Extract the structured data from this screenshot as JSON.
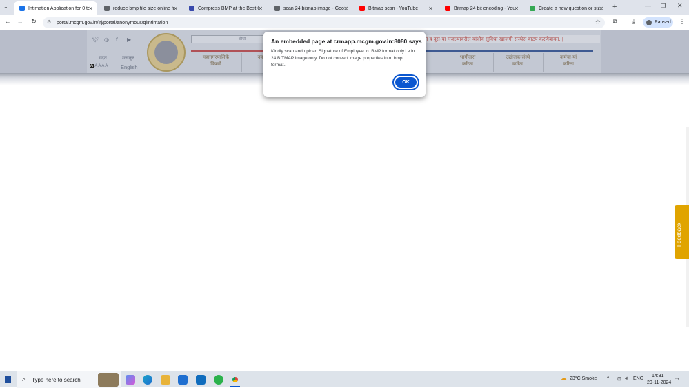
{
  "browser": {
    "tabs": [
      {
        "title": "Intimation Application for 0 to",
        "favicon_color": "#1a73e8",
        "active": true
      },
      {
        "title": "reduce bmp file size online fre",
        "favicon_color": "#5f6368",
        "active": false
      },
      {
        "title": "Compress BMP at the Best Qua",
        "favicon_color": "#3949ab",
        "active": false
      },
      {
        "title": "scan 24 bitmap image - Google",
        "favicon_color": "#5f6368",
        "active": false
      },
      {
        "title": "Bitmap scan - YouTube",
        "favicon_color": "#ff0000",
        "active": false
      },
      {
        "title": "Bitmap 24 bit encoding - YouT",
        "favicon_color": "#ff0000",
        "active": false
      },
      {
        "title": "Create a new question or start",
        "favicon_color": "#34a853",
        "active": false
      }
    ],
    "url": "portal.mcgm.gov.in/irj/portal/anonymous/qlIntimation",
    "profile_label": "Paused"
  },
  "site": {
    "lang_left": "मदत",
    "lang_right": "मजकूर",
    "lang_english": "English",
    "search_placeholder": "शोधा",
    "marquee": "त्या व दुस-या मजल्यावरील बांधीव सुविधा खाजगी संस्थेस वाटप करणेबाबत. |",
    "nav": [
      {
        "line1": "महानगरपालिके",
        "line2": "विषयी"
      },
      {
        "line1": "नकाशे, अ",
        "line2": "अ"
      },
      {
        "line1": "",
        "line2": ""
      },
      {
        "line1": "",
        "line2": ""
      },
      {
        "line1": "भागीदारां",
        "line2": "करिता"
      },
      {
        "line1": "उद्योजक संस्थे",
        "line2": "करिता"
      },
      {
        "line1": "कर्मचा-यां",
        "line2": "करिता"
      }
    ],
    "feedback_label": "Feedback"
  },
  "dialog": {
    "title": "An embedded page at crmapp.mcgm.gov.in:8080 says",
    "message": "Kindly scan and upload Signature of Employee in .BMP format only.i.e in 24 BITMAP image only. Do not convert image properties into .bmp format..",
    "ok_label": "OK"
  },
  "taskbar": {
    "search_placeholder": "Type here to search",
    "weather": "23°C Smoke",
    "language": "ENG",
    "time": "14:31",
    "date": "20-11-2024"
  }
}
